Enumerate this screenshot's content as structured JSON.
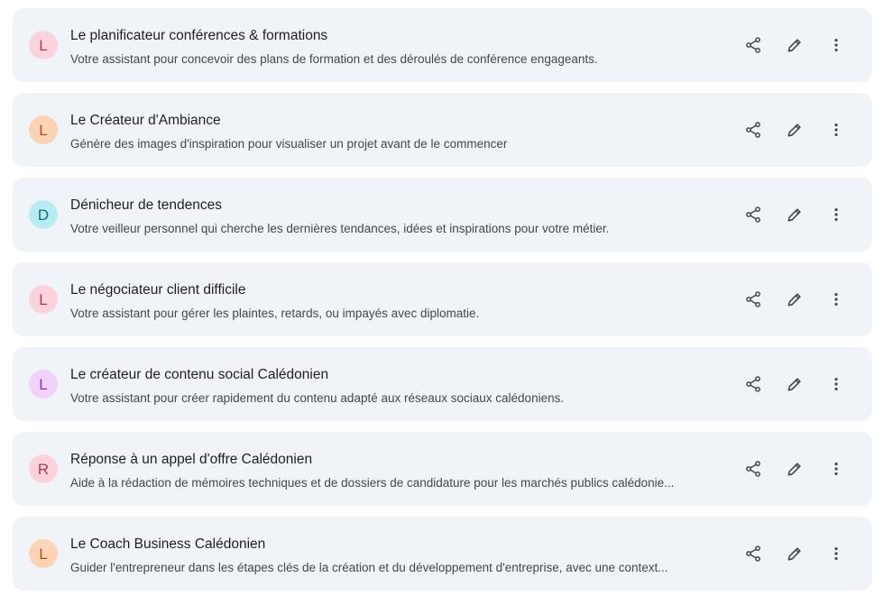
{
  "gems": [
    {
      "initial": "L",
      "title": "Le planificateur conférences & formations",
      "description": "Votre assistant pour concevoir des plans de formation et des déroulés de conférence engageants.",
      "avatar_bg": "#fbd3dc",
      "avatar_fg": "#b3384f"
    },
    {
      "initial": "L",
      "title": "Le Créateur d'Ambiance",
      "description": "Génère des images d'inspiration pour visualiser un projet avant de le commencer",
      "avatar_bg": "#fcd3b5",
      "avatar_fg": "#a8521a"
    },
    {
      "initial": "D",
      "title": "Dénicheur de tendences",
      "description": "Votre veilleur personnel qui cherche les dernières tendances, idées et inspirations pour votre métier.",
      "avatar_bg": "#b9ecf2",
      "avatar_fg": "#176a78"
    },
    {
      "initial": "L",
      "title": "Le négociateur client difficile",
      "description": "Votre assistant pour gérer les plaintes, retards, ou impayés avec diplomatie.",
      "avatar_bg": "#fbd3dc",
      "avatar_fg": "#b3384f"
    },
    {
      "initial": "L",
      "title": "Le créateur de contenu social Calédonien",
      "description": "Votre assistant pour créer rapidement du contenu adapté aux réseaux sociaux calédoniens.",
      "avatar_bg": "#f1d2fb",
      "avatar_fg": "#8a2fb0"
    },
    {
      "initial": "R",
      "title": "Réponse à un appel d'offre Calédonien",
      "description": "Aide à la rédaction de mémoires techniques et de dossiers de candidature pour les marchés publics calédonie...",
      "avatar_bg": "#fbd3dc",
      "avatar_fg": "#b3384f"
    },
    {
      "initial": "L",
      "title": "Le Coach Business Calédonien",
      "description": "Guider l'entrepreneur dans les étapes clés de la création et du développement d'entreprise, avec une context...",
      "avatar_bg": "#fcd3b5",
      "avatar_fg": "#a8521a"
    }
  ],
  "icons": {
    "share": "share-icon",
    "edit": "pencil-icon",
    "more": "more-vert-icon"
  },
  "colors": {
    "card_bg": "#f0f4f9",
    "icon": "#444746"
  }
}
